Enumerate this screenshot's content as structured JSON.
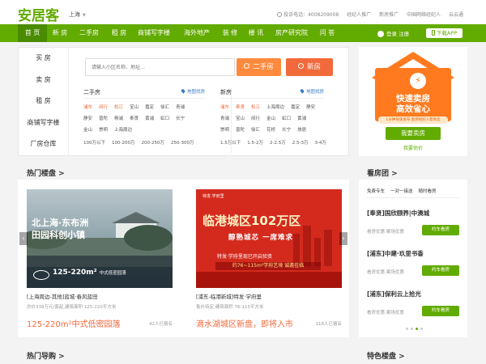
{
  "header": {
    "logo": "安居客",
    "city": "上海",
    "links": [
      "投诉电话：4008209008",
      "经纪人推广",
      "新房推广",
      "中国网络经纪人",
      "云云通"
    ]
  },
  "nav": {
    "items": [
      "首 页",
      "新 房",
      "二手房",
      "租 房",
      "商铺写字楼",
      "海外地产",
      "装 修",
      "楼 讯",
      "房产研究院",
      "问 答"
    ],
    "login": "登录 注册",
    "app": "下载APP"
  },
  "search": {
    "categories": [
      "买 房",
      "卖 房",
      "租 房",
      "商铺写字楼",
      "厂房仓库"
    ],
    "placeholder": "请输入小区名称、地址…",
    "btn_second": "二手房",
    "btn_new": "新房",
    "second": {
      "title": "二手房",
      "map": "地图找房",
      "rows": [
        [
          "浦东",
          "闵行",
          "松江",
          "宝山",
          "嘉定",
          "徐汇",
          "青浦"
        ],
        [
          "静安",
          "普陀",
          "杨浦",
          "奉贤",
          "黄浦",
          "虹口",
          "长宁"
        ],
        [
          "金山",
          "崇明",
          "上海周边"
        ],
        [
          "100万以下",
          "100-200万",
          "200-250万",
          "250-300万"
        ]
      ]
    },
    "newhouse": {
      "title": "新房",
      "map": "地图找房",
      "rows": [
        [
          "浦东",
          "奉贤",
          "松江",
          "上海周边",
          "嘉定",
          "静安"
        ],
        [
          "青浦",
          "宝山",
          "闵行",
          "金山",
          "虹口",
          "黄浦"
        ],
        [
          "崇明",
          "普陀",
          "徐汇",
          "花桥",
          "长宁",
          "旅居"
        ],
        [
          "1.5万以下",
          "1.5-2万",
          "2-2.5万",
          "2.5-3万",
          "3-4万"
        ]
      ]
    }
  },
  "promo": {
    "title_line1": "快速卖房",
    "title_line2": "高效省心",
    "sub": "1分钟快速发布 金牌经纪人帮你卖",
    "sell_btn": "我要卖房",
    "estimate": "我要估价"
  },
  "hot": {
    "title": "热门楼盘 >",
    "cards": [
      {
        "img_text_line1": "北上海·东布洲",
        "img_text_line2": "田园科创小镇",
        "img_banner": "125-220m²",
        "img_banner_small": "中式低密园落",
        "caption": "[上海周边-其他]蓝城·春风蓝田",
        "info": "总价338万元/套起,建筑面积 125-220平方米",
        "price": "125-220m²中式低密园落",
        "count": "42人已报名"
      },
      {
        "img_top": "特发·学府里",
        "img_title": "临港城区102万区",
        "img_sub": "醇熟城芯 一席难求",
        "img_sub2": "特发·学府里现已开启验资",
        "img_sub3": "约76~115m²学府艺境 诚邀莅临",
        "caption": "[浦东-临港新城]特发·学府里",
        "info": "售价待定,建筑面积 76-115平方米",
        "price": "滴水湖城区新盘，即将入市",
        "count": "118人已报名"
      }
    ]
  },
  "tour": {
    "title": "看房团 >",
    "tabs": [
      "免费专车",
      "一对一接送",
      "随时看房"
    ],
    "items": [
      {
        "title": "[奉贤]国欣颐养|中澳城",
        "sub": "看房优惠:案场优惠",
        "btn": "约车看房"
      },
      {
        "title": "[浦东]中建·玖里书香",
        "sub": "看房优惠:案场优惠",
        "btn": "约车看房"
      },
      {
        "title": "[浦东]保利云上拾光",
        "sub": "看房优惠:案场优惠",
        "btn": "约车看房"
      }
    ]
  },
  "guide": {
    "title": "热门导购 >"
  },
  "featured": {
    "title": "特色楼盘 >"
  }
}
